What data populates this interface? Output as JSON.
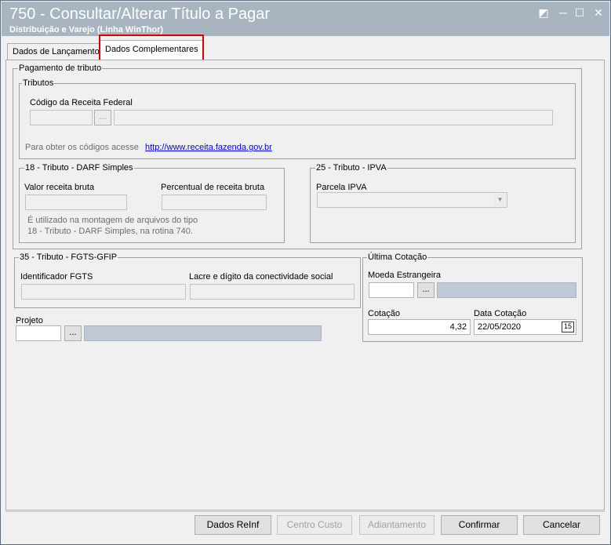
{
  "window": {
    "title": "750 - Consultar/Alterar Título a Pagar",
    "subtitle": "Distribuição e Varejo (Linha WinThor)",
    "controls": {
      "restore": "◩",
      "minimize": "─",
      "maximize": "☐",
      "close": "✕"
    }
  },
  "tabs": [
    {
      "label": "Dados de Lançamento",
      "active": false
    },
    {
      "label": "Dados Complementares",
      "active": true
    }
  ],
  "pagamento": {
    "legend": "Pagamento de tributo",
    "tributos": {
      "legend": "Tributos",
      "codigo_label": "Código da Receita Federal",
      "codigo_value": "",
      "browse": "...",
      "descricao_value": "",
      "info_text": "Para obter os códigos acesse",
      "link": "http://www.receita.fazenda.gov.br"
    },
    "darf": {
      "legend": "18 - Tributo - DARF Simples",
      "valor_label": "Valor receita bruta",
      "valor_value": "",
      "percentual_label": "Percentual de receita bruta",
      "percentual_value": "",
      "note_line1": "É utilizado na montagem de arquivos do tipo",
      "note_line2": "18 - Tributo - DARF Simples, na rotina 740."
    },
    "ipva": {
      "legend": "25 - Tributo - IPVA",
      "parcela_label": "Parcela IPVA",
      "parcela_value": ""
    }
  },
  "fgts": {
    "legend": "35 - Tributo - FGTS-GFIP",
    "identificador_label": "Identificador FGTS",
    "identificador_value": "",
    "lacre_label": "Lacre e dígito da conectividade social",
    "lacre_value": ""
  },
  "projeto": {
    "label": "Projeto",
    "code_value": "",
    "browse": "...",
    "desc_value": ""
  },
  "cotacao": {
    "legend": "Última Cotação",
    "moeda_label": "Moeda Estrangeira",
    "moeda_value": "",
    "browse": "...",
    "moeda_desc": "",
    "cotacao_label": "Cotação",
    "cotacao_value": "4,32",
    "data_label": "Data Cotação",
    "data_value": "22/05/2020",
    "calendar_icon_text": "15"
  },
  "buttons": {
    "reinf": "Dados ReInf",
    "centro_custo": "Centro Custo",
    "adiantamento": "Adiantamento",
    "confirmar": "Confirmar",
    "cancelar": "Cancelar"
  },
  "colors": {
    "titlebar": "#a8b4c0",
    "highlight": "#e00000",
    "link": "#0000ee"
  }
}
